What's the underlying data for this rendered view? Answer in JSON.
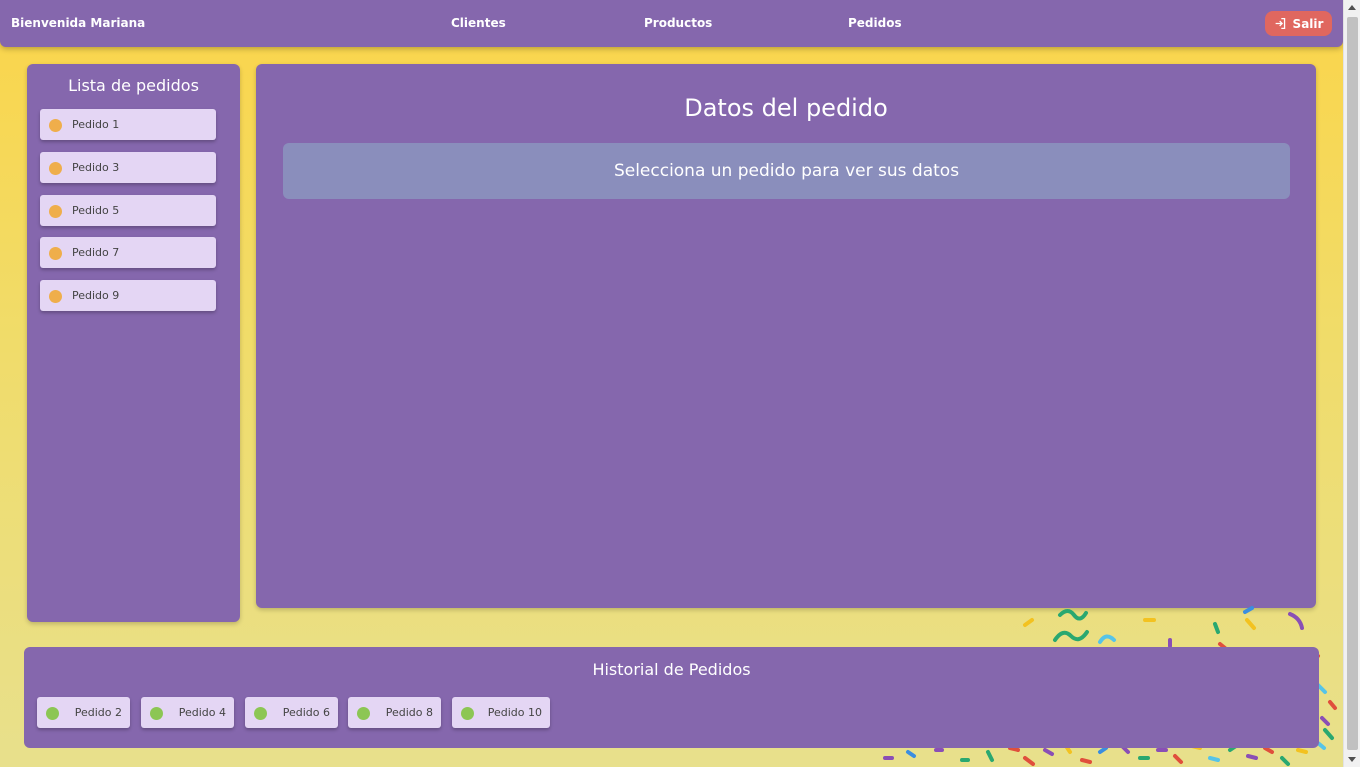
{
  "navbar": {
    "welcome": "Bienvenida Mariana",
    "links": [
      "Clientes",
      "Productos",
      "Pedidos"
    ],
    "logout_label": "Salir"
  },
  "pending_orders": {
    "title": "Lista de pedidos",
    "items": [
      "Pedido 1",
      "Pedido 3",
      "Pedido 5",
      "Pedido 7",
      "Pedido 9"
    ]
  },
  "order_details": {
    "title": "Datos del pedido",
    "placeholder": "Selecciona un pedido para ver sus datos"
  },
  "history": {
    "title": "Historial de Pedidos",
    "items": [
      "Pedido 2",
      "Pedido 4",
      "Pedido 6",
      "Pedido 8",
      "Pedido 10"
    ]
  },
  "colors": {
    "panel": "#8567ad",
    "card": "#e4d6f4",
    "pending_dot": "#efae4b",
    "done_dot": "#8cc654",
    "logout": "#e0675f",
    "background": "#fbd54a"
  }
}
